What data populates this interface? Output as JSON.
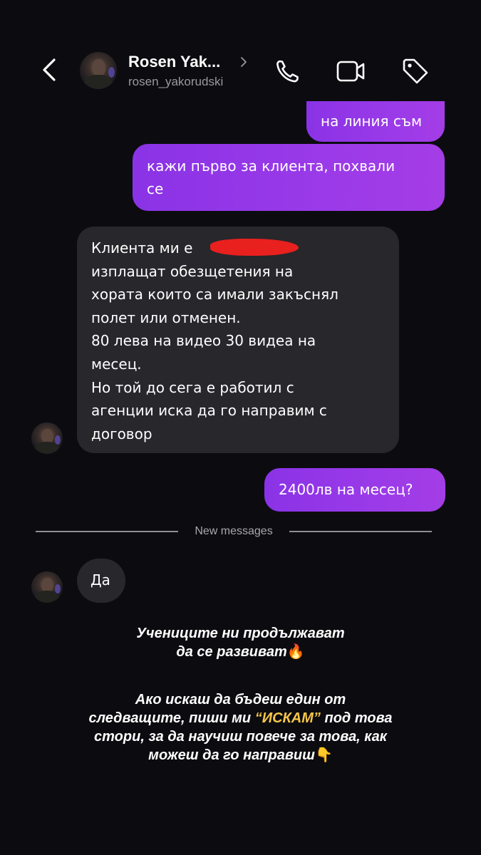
{
  "header": {
    "contact_name": "Rosen Yak...",
    "contact_handle": "rosen_yakorudski",
    "icons": [
      "back-chevron-icon",
      "phone-icon",
      "video-camera-icon",
      "tag-icon",
      "chevron-right-icon"
    ]
  },
  "messages": [
    {
      "direction": "outgoing",
      "text": "на линия съм"
    },
    {
      "direction": "outgoing",
      "text": "кажи първо за клиента, похвали\nсе"
    },
    {
      "direction": "incoming",
      "text": "Клиента ми е\nизплащат обезщетения на\nхората които са имали закъснял\nполет или отменен.\n80 лева на видео 30 видеа на\nмесец.\nНо той до сега е работил с\nагенции иска да го направим с\nдоговор"
    },
    {
      "direction": "outgoing",
      "text": "2400лв на месец?"
    },
    {
      "direction": "incoming",
      "text": "Да"
    }
  ],
  "divider_label": "New messages",
  "story_text": {
    "block1": [
      "Учениците ни продължават",
      "да се развиват"
    ],
    "block1_emoji": "🔥",
    "block2_line1": "Ако искаш да бъдеш един от",
    "block2_line2_pre": "следващите, пиши ми ",
    "block2_highlight": "“ИСКАМ”",
    "block2_line2_post": " под това",
    "block2_line3": "стори, за да научиш повече за това, как",
    "block2_line4": "можеш да го направиш",
    "block2_emoji": "👇"
  },
  "colors": {
    "background": "#0c0c10",
    "outgoing_bubble": "#9a3ae8",
    "incoming_bubble": "#27272c",
    "highlight": "#f7c64a",
    "redaction": "#e8201e"
  }
}
